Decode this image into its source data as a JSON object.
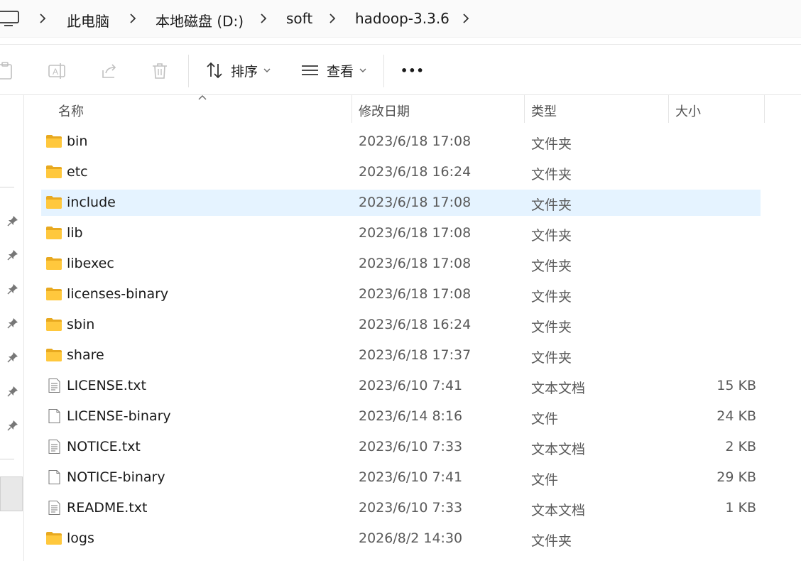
{
  "breadcrumb": {
    "items": [
      "此电脑",
      "本地磁盘 (D:)",
      "soft",
      "hadoop-3.3.6"
    ]
  },
  "toolbar": {
    "sort_label": "排序",
    "view_label": "查看",
    "more_label": "•••"
  },
  "columns": {
    "name": "名称",
    "date": "修改日期",
    "type": "类型",
    "size": "大小"
  },
  "files": [
    {
      "name": "bin",
      "date": "2023/6/18 17:08",
      "type": "文件夹",
      "size": "",
      "icon": "folder-icon"
    },
    {
      "name": "etc",
      "date": "2023/6/18 16:24",
      "type": "文件夹",
      "size": "",
      "icon": "folder-icon"
    },
    {
      "name": "include",
      "date": "2023/6/18 17:08",
      "type": "文件夹",
      "size": "",
      "icon": "folder-icon",
      "selected": true
    },
    {
      "name": "lib",
      "date": "2023/6/18 17:08",
      "type": "文件夹",
      "size": "",
      "icon": "folder-icon"
    },
    {
      "name": "libexec",
      "date": "2023/6/18 17:08",
      "type": "文件夹",
      "size": "",
      "icon": "folder-icon"
    },
    {
      "name": "licenses-binary",
      "date": "2023/6/18 17:08",
      "type": "文件夹",
      "size": "",
      "icon": "folder-icon"
    },
    {
      "name": "sbin",
      "date": "2023/6/18 16:24",
      "type": "文件夹",
      "size": "",
      "icon": "folder-icon"
    },
    {
      "name": "share",
      "date": "2023/6/18 17:37",
      "type": "文件夹",
      "size": "",
      "icon": "folder-icon"
    },
    {
      "name": "LICENSE.txt",
      "date": "2023/6/10 7:41",
      "type": "文本文档",
      "size": "15 KB",
      "icon": "text-file-icon"
    },
    {
      "name": "LICENSE-binary",
      "date": "2023/6/14 8:16",
      "type": "文件",
      "size": "24 KB",
      "icon": "file-icon"
    },
    {
      "name": "NOTICE.txt",
      "date": "2023/6/10 7:33",
      "type": "文本文档",
      "size": "2 KB",
      "icon": "text-file-icon"
    },
    {
      "name": "NOTICE-binary",
      "date": "2023/6/10 7:41",
      "type": "文件",
      "size": "29 KB",
      "icon": "file-icon"
    },
    {
      "name": "README.txt",
      "date": "2023/6/10 7:33",
      "type": "文本文档",
      "size": "1 KB",
      "icon": "text-file-icon"
    },
    {
      "name": "logs",
      "date": "2026/8/2 14:30",
      "type": "文件夹",
      "size": "",
      "icon": "folder-icon"
    }
  ],
  "colors": {
    "selection": "#e5f3ff",
    "folder": "#ffc83d"
  }
}
